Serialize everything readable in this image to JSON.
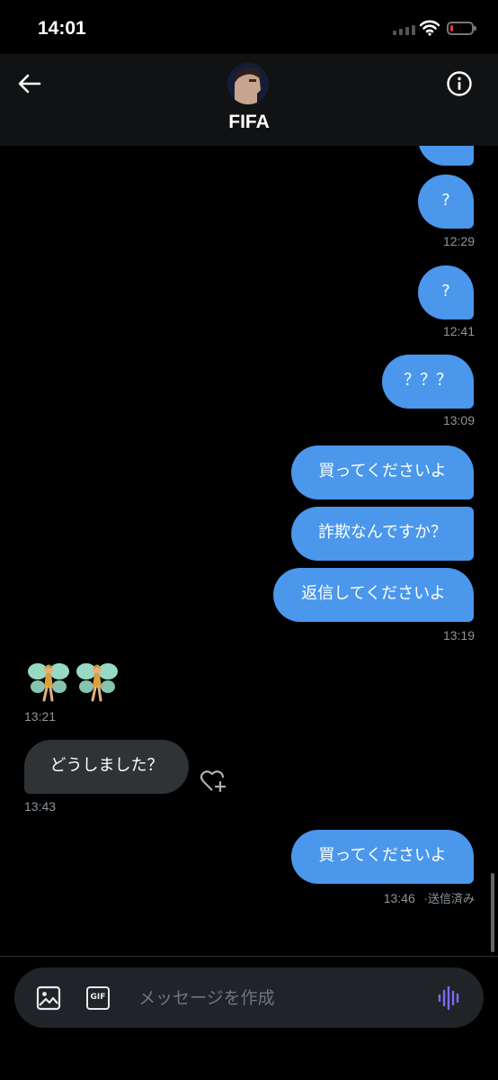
{
  "status_bar": {
    "time": "14:01"
  },
  "header": {
    "contact_name": "FIFA"
  },
  "messages": {
    "m0_label": "?",
    "m1_label": "?",
    "m1_time": "12:29",
    "m2_label": "?",
    "m2_time": "12:41",
    "m3_label": "？？？",
    "m3_time": "13:09",
    "m4_label": "買ってくださいよ",
    "m5_label": "詐欺なんですか？",
    "m6_label": "返信してくださいよ",
    "m6_time": "13:19",
    "fairy_emoji_time": "13:21",
    "m7_label": "どうしました？",
    "m7_time": "13:43",
    "m8_label": "買ってくださいよ",
    "m8_time": "13:46",
    "m8_status": "·送信済み"
  },
  "compose": {
    "placeholder": "メッセージを作成",
    "gif_label": "GIF"
  },
  "colors": {
    "sent_bubble": "#4a97ec",
    "received_bubble": "#2f3336",
    "voice_accent": "#7c6cf6",
    "battery_low": "#e53935"
  },
  "battery_level": 0.12
}
